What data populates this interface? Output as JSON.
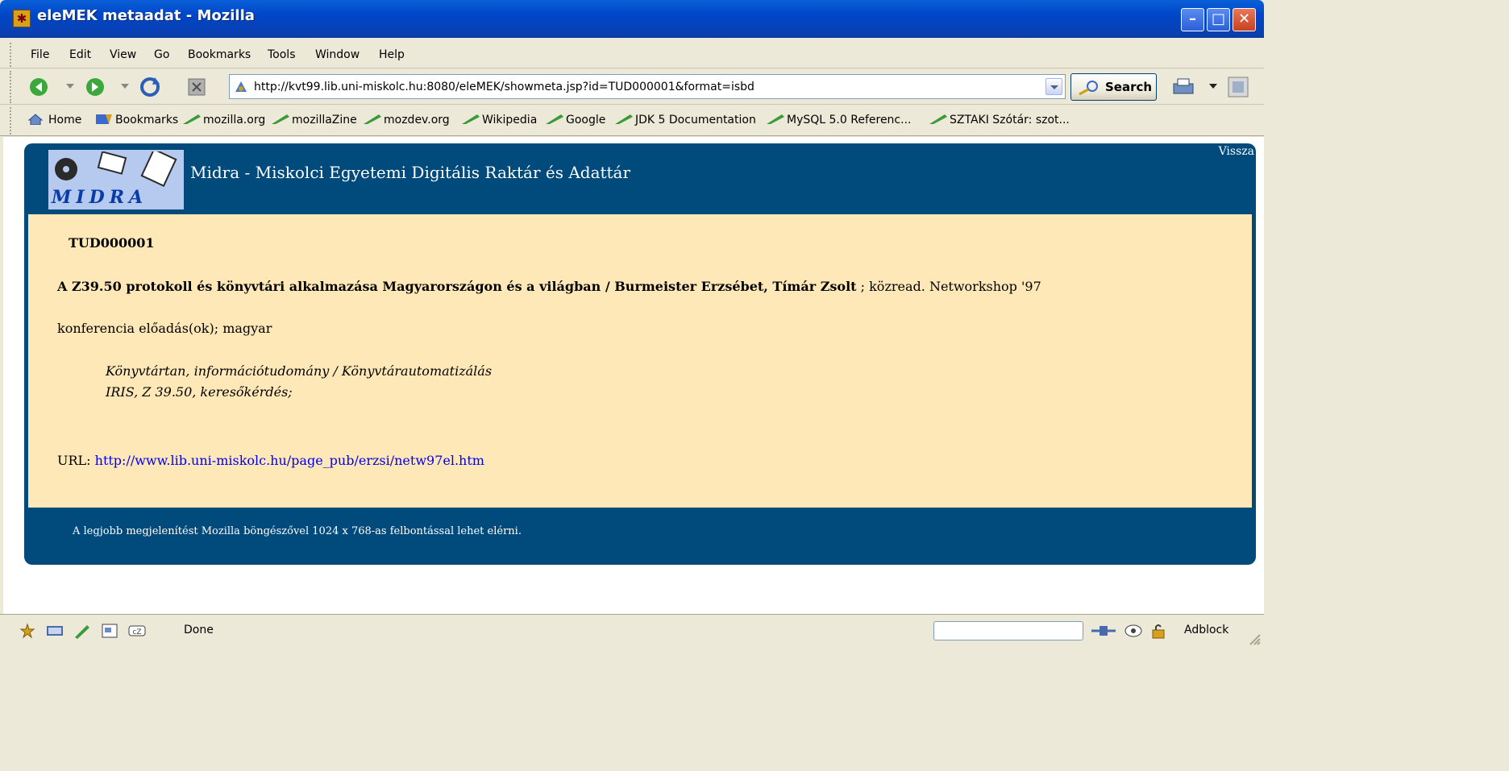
{
  "window": {
    "title": "eleMEK metaadat - Mozilla"
  },
  "menu": [
    "File",
    "Edit",
    "View",
    "Go",
    "Bookmarks",
    "Tools",
    "Window",
    "Help"
  ],
  "nav": {
    "url": "http://kvt99.lib.uni-miskolc.hu:8080/eleMEK/showmeta.jsp?id=TUD000001&format=isbd",
    "search_label": "Search"
  },
  "bookmarks": [
    "Home",
    "Bookmarks",
    "mozilla.org",
    "mozillaZine",
    "mozdev.org",
    "Wikipedia",
    "Google",
    "JDK 5 Documentation",
    "MySQL 5.0 Referenc...",
    "SZTAKI Szótár: szot..."
  ],
  "page": {
    "logo_text": "MIDRA",
    "header_title": "Midra - Miskolci Egyetemi Digitális Raktár és Adattár",
    "back_link": "Vissza",
    "record_id": "TUD000001",
    "record_title_bold": "A Z39.50 protokoll és könyvtári alkalmazása Magyarországon és a világban / Burmeister Erzsébet, Tímár Zsolt",
    "record_title_rest": " ; közread. Networkshop '97",
    "record_type": "konferencia előadás(ok); magyar",
    "subject_line1": "Könyvtártan, információtudomány / Könyvtárautomatizálás",
    "subject_line2": "IRIS, Z 39.50, keresőkérdés;",
    "url_label": "URL: ",
    "url_link": "http://www.lib.uni-miskolc.hu/page_pub/erzsi/netw97el.htm",
    "footer_note": "A legjobb megjelenítést Mozilla böngészővel 1024 x 768-as felbontással lehet elérni."
  },
  "status": {
    "text": "Done",
    "adblock": "Adblock"
  },
  "colors": {
    "header_bg": "#004a7c",
    "body_bg": "#ffe8b8",
    "link": "#0000ee"
  }
}
